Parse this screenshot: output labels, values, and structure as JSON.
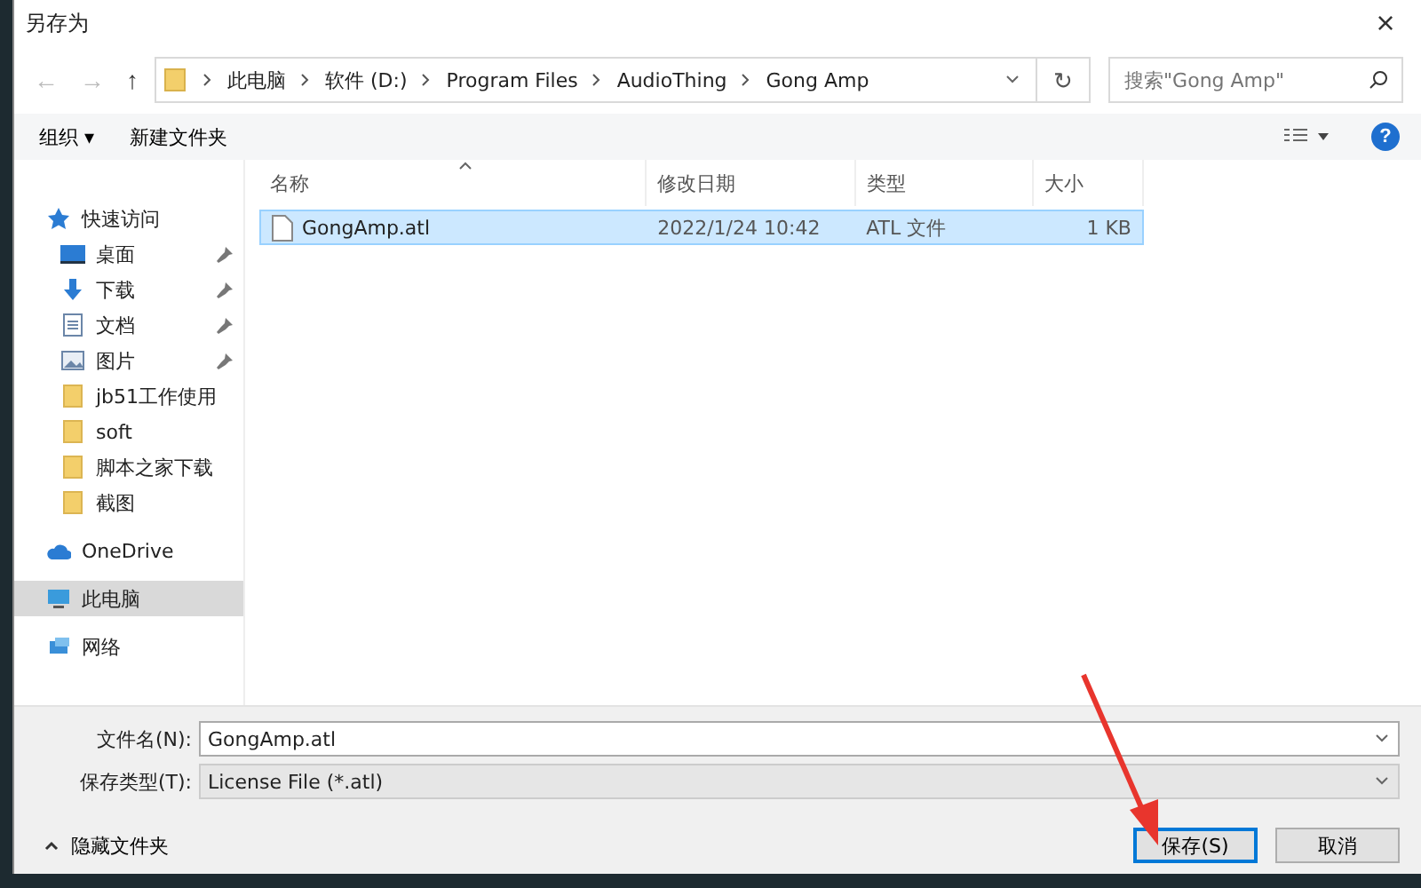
{
  "window": {
    "title": "另存为",
    "close": "×"
  },
  "address": {
    "nav": [
      "←",
      "→",
      "↑"
    ],
    "crumbs": [
      "此电脑",
      "软件 (D:)",
      "Program Files",
      "AudioThing",
      "Gong Amp"
    ],
    "refresh": "↻"
  },
  "search": {
    "placeholder": "搜索\"Gong Amp\""
  },
  "toolbar": {
    "organize": "组织 ▾",
    "new_folder": "新建文件夹",
    "help": "?"
  },
  "sidebar": {
    "items": [
      {
        "label": "快速访问",
        "kind": "star",
        "selected": false,
        "children": [
          {
            "label": "桌面",
            "kind": "desktop",
            "selected": false,
            "pinned": true
          },
          {
            "label": "下载",
            "kind": "download",
            "selected": false,
            "pinned": true
          },
          {
            "label": "文档",
            "kind": "document",
            "selected": false,
            "pinned": true
          },
          {
            "label": "图片",
            "kind": "pictures",
            "selected": false,
            "pinned": true
          },
          {
            "label": "jb51工作使用",
            "kind": "folder",
            "selected": false,
            "pinned": false
          },
          {
            "label": "soft",
            "kind": "folder",
            "selected": false,
            "pinned": false
          },
          {
            "label": "脚本之家下载",
            "kind": "folder",
            "selected": false,
            "pinned": false
          },
          {
            "label": "截图",
            "kind": "folder",
            "selected": false,
            "pinned": false
          }
        ]
      },
      {
        "label": "OneDrive",
        "kind": "cloud",
        "selected": false
      },
      {
        "label": "此电脑",
        "kind": "pc",
        "selected": true
      },
      {
        "label": "网络",
        "kind": "network",
        "selected": false
      }
    ]
  },
  "table": {
    "columns": [
      "名称",
      "修改日期",
      "类型",
      "大小"
    ],
    "rows": [
      {
        "cells": [
          "GongAmp.atl",
          "2022/1/24 10:42",
          "ATL 文件",
          "1 KB"
        ],
        "selected": true
      }
    ]
  },
  "form": {
    "filename_label": "文件名(N):",
    "filename": "GongAmp.atl",
    "type_label": "保存类型(T):",
    "type": "License File (*.atl)"
  },
  "footer": {
    "hide_folders": "隐藏文件夹",
    "buttons": [
      "保存(S)",
      "取消"
    ]
  }
}
